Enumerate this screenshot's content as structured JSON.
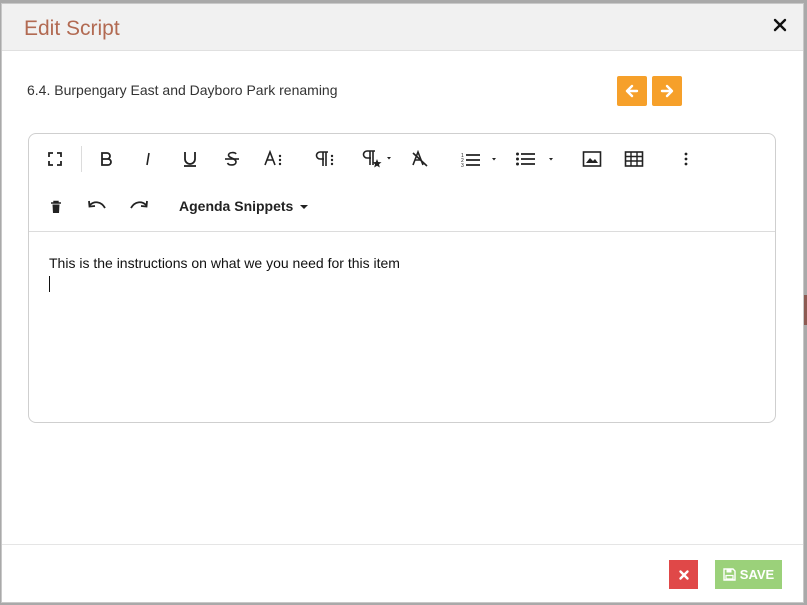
{
  "modal": {
    "title": "Edit Script",
    "item_title": "6.4. Burpengary East and Dayboro Park renaming"
  },
  "toolbar": {
    "snippets_label": "Agenda Snippets"
  },
  "editor": {
    "content": "This is the instructions on what we you need for this item"
  },
  "footer": {
    "save_label": "SAVE"
  },
  "colors": {
    "title": "#b26a52",
    "nav_button": "#f6a02a",
    "cancel_button": "#e04848",
    "save_button": "#9bd17a"
  }
}
